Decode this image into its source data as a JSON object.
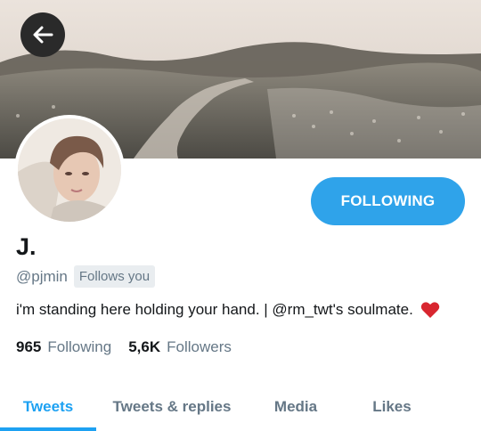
{
  "profile": {
    "display_name": "J.",
    "handle": "@pjmin",
    "follows_you_badge": "Follows you",
    "bio": "i'm standing here holding your hand. | @rm_twt's soulmate.",
    "bio_emoji": "heart-icon"
  },
  "actions": {
    "follow_label": "FOLLOWING"
  },
  "stats": {
    "following_count": "965",
    "following_label": "Following",
    "followers_count": "5,6K",
    "followers_label": "Followers"
  },
  "tabs": [
    {
      "label": "Tweets",
      "active": true
    },
    {
      "label": "Tweets & replies",
      "active": false
    },
    {
      "label": "Media",
      "active": false
    },
    {
      "label": "Likes",
      "active": false
    }
  ],
  "colors": {
    "accent": "#1da1f2",
    "follow_button": "#2fa3ea",
    "secondary_text": "#657786",
    "heart": "#d8262f"
  },
  "icons": {
    "back": "arrow-left-icon"
  }
}
